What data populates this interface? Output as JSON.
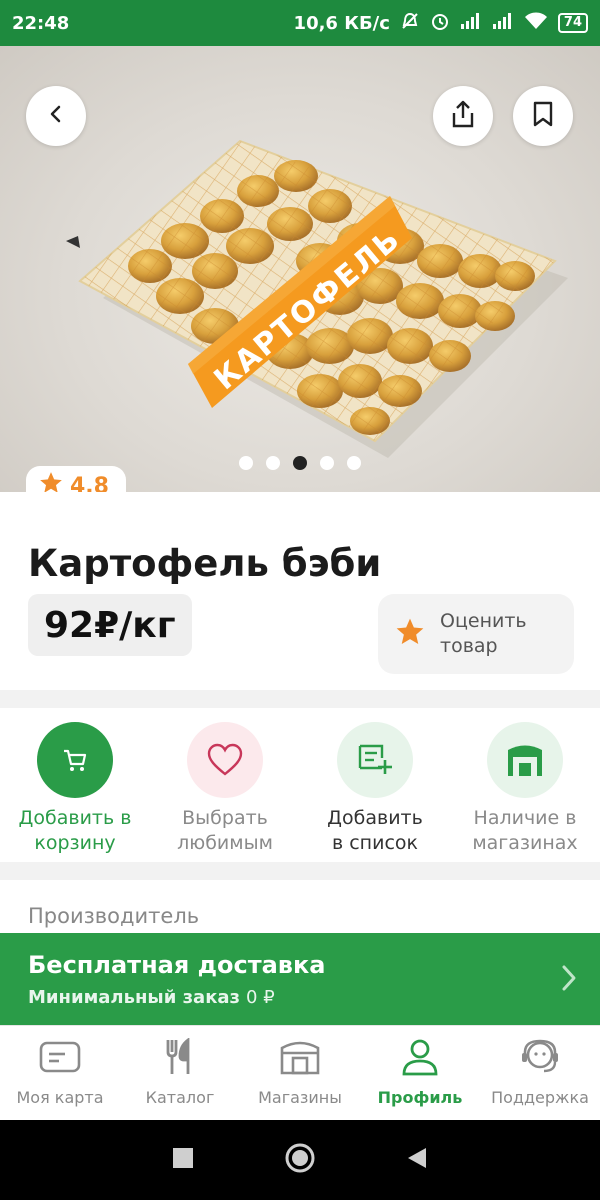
{
  "status_bar": {
    "time": "22:48",
    "network_speed": "10,6 КБ/с",
    "battery": "74",
    "icons": [
      "mute-alarm-icon",
      "alarm-icon",
      "signal-icon",
      "signal-icon",
      "wifi-icon",
      "battery-icon"
    ]
  },
  "hero": {
    "bag_label": "КАРТОФЕЛЬ",
    "back_icon": "chevron-left-icon",
    "share_icon": "share-icon",
    "bookmark_icon": "bookmark-icon",
    "carousel_total": 5,
    "carousel_active_index": 2
  },
  "rating": {
    "value": "4.8",
    "icon": "star-icon"
  },
  "product": {
    "title": "Картофель бэби",
    "price": "92₽/кг",
    "rate_button": "Оценить товар"
  },
  "actions": [
    {
      "line1": "Добавить в",
      "line2": "корзину",
      "icon": "cart-icon"
    },
    {
      "line1": "Выбрать",
      "line2": "любимым",
      "icon": "heart-icon"
    },
    {
      "line1": "Добавить",
      "line2": "в список",
      "icon": "list-add-icon"
    },
    {
      "line1": "Наличие в",
      "line2": "магазинах",
      "icon": "store-icon"
    }
  ],
  "manufacturer": {
    "label": "Производитель"
  },
  "delivery": {
    "title": "Бесплатная доставка",
    "subtitle": "Минимальный заказ",
    "min_value": "0 ₽"
  },
  "bottom_nav": [
    {
      "label": "Моя карта",
      "icon": "card-icon"
    },
    {
      "label": "Каталог",
      "icon": "cutlery-icon"
    },
    {
      "label": "Магазины",
      "icon": "store-icon"
    },
    {
      "label": "Профиль",
      "icon": "profile-icon",
      "active": true
    },
    {
      "label": "Поддержка",
      "icon": "support-icon"
    }
  ],
  "colors": {
    "brand_green": "#2a9c48",
    "status_green": "#1e8a3e",
    "rating_orange": "#f08c2a",
    "heart_pink": "#fce9ec"
  }
}
